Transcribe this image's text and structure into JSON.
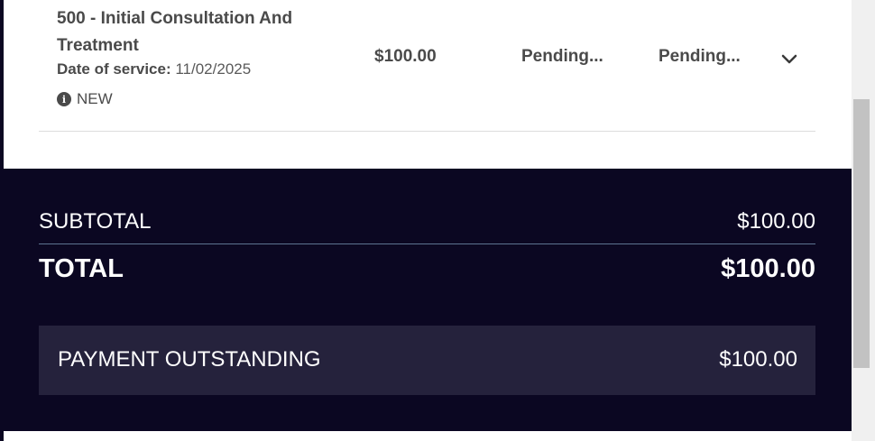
{
  "line_item": {
    "title": "500 - Initial Consultation And Treatment",
    "date_label": "Date of service:",
    "date_value": "11/02/2025",
    "status": "NEW",
    "amount": "$100.00",
    "col_pending_1": "Pending...",
    "col_pending_2": "Pending...",
    "status_icon": "info-icon",
    "expand_icon": "chevron-down-icon"
  },
  "summary": {
    "subtotal_label": "SUBTOTAL",
    "subtotal_value": "$100.00",
    "total_label": "TOTAL",
    "total_value": "$100.00",
    "outstanding_label": "PAYMENT OUTSTANDING",
    "outstanding_value": "$100.00"
  },
  "colors": {
    "summary_bg": "#0b0722",
    "outstanding_bg": "#25223c",
    "text_dark": "#4a4a4a"
  }
}
